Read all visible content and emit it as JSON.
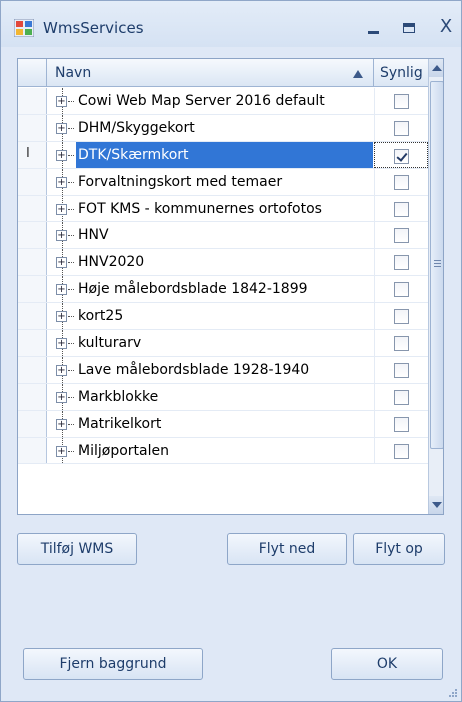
{
  "window": {
    "title": "WmsServices"
  },
  "grid": {
    "columns": {
      "name": "Navn",
      "visible": "Synlig"
    },
    "rows": [
      {
        "name": "Cowi Web Map Server 2016 default",
        "checked": false
      },
      {
        "name": "DHM/Skyggekort",
        "checked": false
      },
      {
        "name": "DTK/Skærmkort",
        "checked": true,
        "selected": true
      },
      {
        "name": "Forvaltningskort med temaer",
        "checked": false
      },
      {
        "name": "FOT KMS - kommunernes ortofotos",
        "checked": false
      },
      {
        "name": "HNV",
        "checked": false
      },
      {
        "name": "HNV2020",
        "checked": false
      },
      {
        "name": "Høje målebordsblade 1842-1899",
        "checked": false
      },
      {
        "name": "kort25",
        "checked": false
      },
      {
        "name": "kulturarv",
        "checked": false
      },
      {
        "name": "Lave målebordsblade 1928-1940",
        "checked": false
      },
      {
        "name": "Markblokke",
        "checked": false
      },
      {
        "name": "Matrikelkort",
        "checked": false
      },
      {
        "name": "Miljøportalen",
        "checked": false
      }
    ]
  },
  "buttons": {
    "add": "Tilføj WMS",
    "move_down": "Flyt ned",
    "move_up": "Flyt op",
    "remove_background": "Fjern baggrund",
    "ok": "OK"
  },
  "colors": {
    "selection": "#3176d6",
    "chrome": "#dfe8f6",
    "title_text": "#1e3d6b"
  }
}
